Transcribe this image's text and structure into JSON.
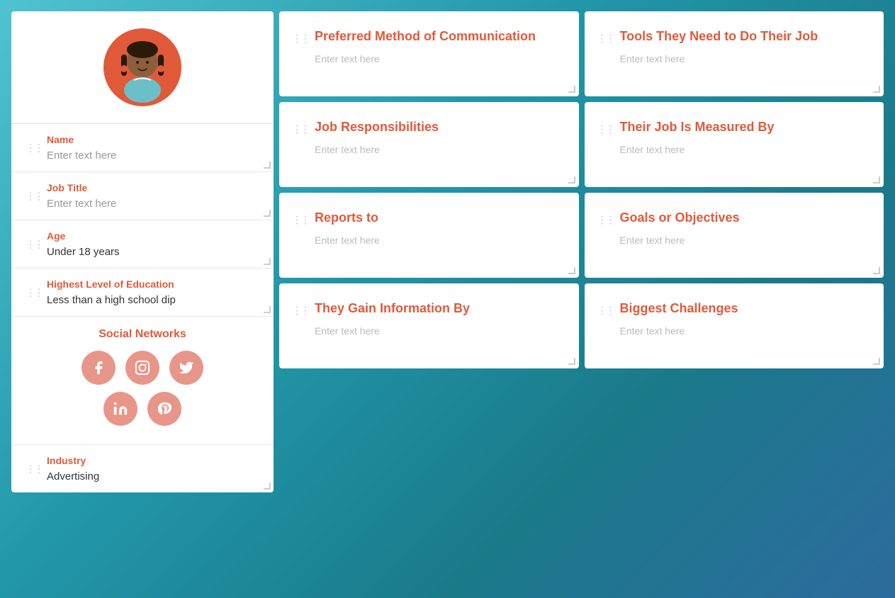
{
  "left": {
    "name_label": "Name",
    "name_value": "Enter text here",
    "job_title_label": "Job Title",
    "job_title_value": "Enter text here",
    "age_label": "Age",
    "age_value": "Under 18 years",
    "education_label": "Highest Level of Education",
    "education_value": "Less than a high school dip",
    "social_title": "Social Networks",
    "industry_label": "Industry",
    "industry_value": "Advertising"
  },
  "cards": [
    {
      "title": "Preferred Method of Communication",
      "placeholder": "Enter text here"
    },
    {
      "title": "Tools They Need to Do Their Job",
      "placeholder": "Enter text here"
    },
    {
      "title": "Job Responsibilities",
      "placeholder": "Enter text here"
    },
    {
      "title": "Their Job Is Measured By",
      "placeholder": "Enter text here"
    },
    {
      "title": "Reports to",
      "placeholder": "Enter text here"
    },
    {
      "title": "Goals or Objectives",
      "placeholder": "Enter text here"
    },
    {
      "title": "They Gain Information By",
      "placeholder": "Enter text here"
    },
    {
      "title": "Biggest Challenges",
      "placeholder": "Enter text here"
    }
  ],
  "social_icons": [
    "f",
    "in_circle",
    "tw",
    "li",
    "pi"
  ]
}
